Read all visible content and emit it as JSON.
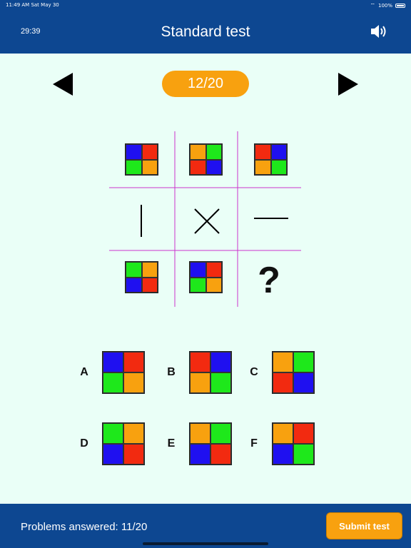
{
  "status_bar": {
    "time_date": "11:49 AM  Sat May 30",
    "battery": "100%"
  },
  "header": {
    "timer": "29:39",
    "title": "Standard test",
    "sound_icon": "speaker-icon"
  },
  "navigation": {
    "counter": "12/20",
    "prev_icon": "triangle-left-icon",
    "next_icon": "triangle-right-icon"
  },
  "colors": {
    "blue": "#1f10f0",
    "red": "#f22a10",
    "green": "#1ee81b",
    "orange": "#f8a10f",
    "header_bg": "#0d4791",
    "grid_line": "#cc33cc"
  },
  "puzzle": {
    "row1": [
      [
        "blue",
        "red",
        "green",
        "orange"
      ],
      [
        "orange",
        "green",
        "red",
        "blue"
      ],
      [
        "red",
        "blue",
        "orange",
        "green"
      ]
    ],
    "row2_symbols": [
      "vertical-line-icon",
      "cross-icon",
      "horizontal-line-icon"
    ],
    "row3": [
      [
        "green",
        "orange",
        "blue",
        "red"
      ],
      [
        "blue",
        "red",
        "green",
        "orange"
      ]
    ],
    "missing": "?"
  },
  "options": [
    {
      "label": "A",
      "colors": [
        "blue",
        "red",
        "green",
        "orange"
      ]
    },
    {
      "label": "B",
      "colors": [
        "red",
        "blue",
        "orange",
        "green"
      ]
    },
    {
      "label": "C",
      "colors": [
        "orange",
        "green",
        "red",
        "blue"
      ]
    },
    {
      "label": "D",
      "colors": [
        "green",
        "orange",
        "blue",
        "red"
      ]
    },
    {
      "label": "E",
      "colors": [
        "orange",
        "green",
        "blue",
        "red"
      ]
    },
    {
      "label": "F",
      "colors": [
        "orange",
        "red",
        "blue",
        "green"
      ]
    }
  ],
  "footer": {
    "answered": "Problems answered: 11/20",
    "submit_label": "Submit test"
  }
}
